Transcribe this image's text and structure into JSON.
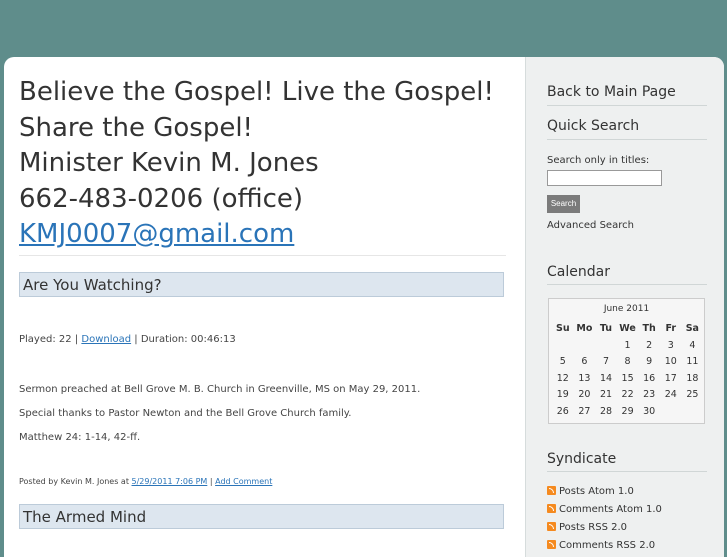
{
  "header": {
    "title_lines": [
      "Believe the Gospel! Live the Gospel!",
      "Share the Gospel!",
      "Minister Kevin M. Jones",
      "662-483-0206 (office)"
    ],
    "email": "KMJ0007@gmail.com"
  },
  "posts": [
    {
      "title": "Are You Watching?",
      "played_prefix": "Played: 22 |",
      "download_label": "Download",
      "duration": "| Duration: 00:46:13",
      "body": [
        "Sermon preached at Bell Grove M. B. Church in Greenville, MS on May 29, 2011.",
        "Special thanks to Pastor Newton and the Bell Grove Church family.",
        "Matthew 24: 1-14, 42-ff."
      ],
      "posted_by": "Posted by Kevin M. Jones at",
      "posted_date": "5/29/2011 7:06 PM",
      "separator": "|",
      "add_comment": "Add Comment"
    },
    {
      "title": "The Armed Mind"
    }
  ],
  "sidebar": {
    "back_link": "Back to Main Page",
    "quick_search": {
      "heading": "Quick Search",
      "label": "Search only in titles:",
      "input_value": "",
      "button": "Search",
      "advanced": "Advanced Search"
    },
    "calendar": {
      "heading": "Calendar",
      "month": "June 2011",
      "days": [
        "Su",
        "Mo",
        "Tu",
        "We",
        "Th",
        "Fr",
        "Sa"
      ],
      "leading_blanks": 3,
      "day_count": 30
    },
    "syndicate": {
      "heading": "Syndicate",
      "feeds": [
        "Posts Atom 1.0",
        "Comments Atom 1.0",
        "Posts RSS 2.0",
        "Comments RSS 2.0"
      ]
    }
  }
}
